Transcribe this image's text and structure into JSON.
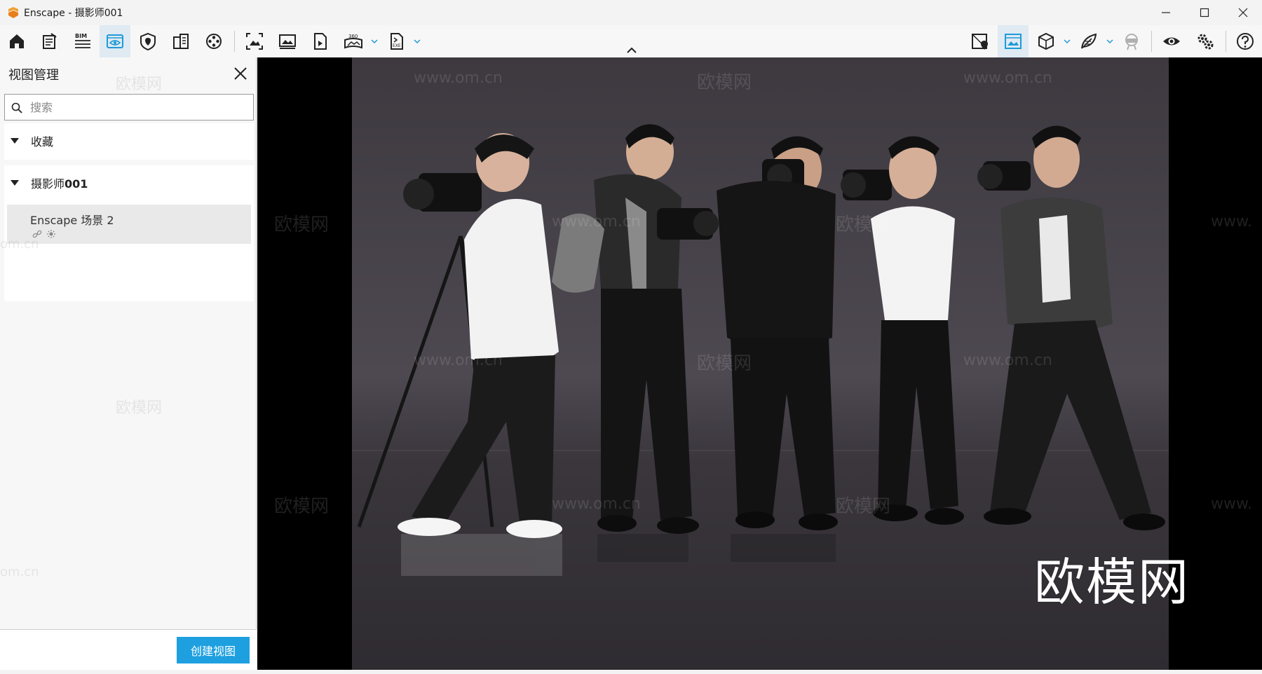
{
  "window": {
    "title": "Enscape - 摄影师001",
    "minimize_icon": "minimize-icon",
    "maximize_icon": "maximize-icon",
    "close_icon": "close-icon"
  },
  "toolbar": {
    "bim_label": "BIM",
    "pano_label": "360",
    "exe_label": "EXE",
    "active_color": "#dfeaf3",
    "accent": "#1e9bd7"
  },
  "panel": {
    "title": "视图管理",
    "search_placeholder": "搜索",
    "groups": [
      {
        "label": "收藏"
      },
      {
        "label": "摄影师001"
      }
    ],
    "views": [
      {
        "name": "Enscape 场景 2"
      }
    ],
    "create_label": "创建视图",
    "create_color": "#1ea0e0"
  },
  "viewport": {
    "watermark_site": "www.om.cn",
    "watermark_brand": "欧模网",
    "watermark_partial": "om.cn",
    "watermark_partial_2": "www.",
    "logo_text": "欧模网"
  }
}
